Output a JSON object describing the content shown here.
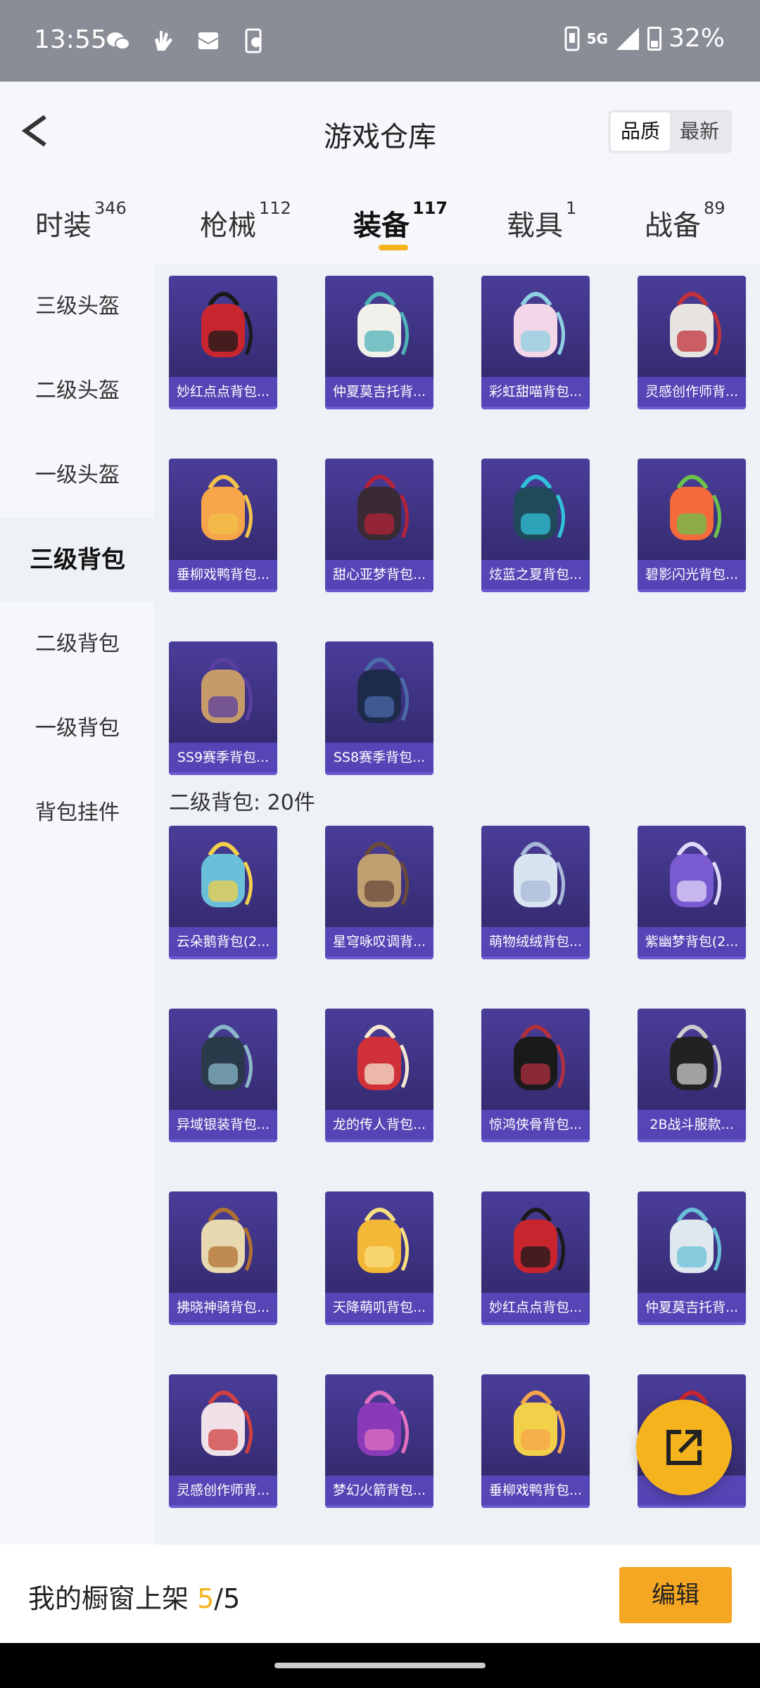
{
  "status_bar": {
    "time": "13:55",
    "network": "5G",
    "battery": "32%"
  },
  "header": {
    "title": "游戏仓库",
    "sort_options": [
      "品质",
      "最新"
    ]
  },
  "tabs": [
    {
      "label": "时装",
      "count": "346"
    },
    {
      "label": "枪械",
      "count": "112"
    },
    {
      "label": "装备",
      "count": "117"
    },
    {
      "label": "载具",
      "count": "1"
    },
    {
      "label": "战备",
      "count": "89"
    }
  ],
  "sidebar": {
    "items": [
      "三级头盔",
      "二级头盔",
      "一级头盔",
      "三级背包",
      "二级背包",
      "一级背包",
      "背包挂件"
    ],
    "active_index": 3
  },
  "level3_items": [
    "妙红点点背包...",
    "仲夏莫吉托背...",
    "彩虹甜喵背包...",
    "灵感创作师背...",
    "垂柳戏鸭背包...",
    "甜心亚梦背包...",
    "炫蓝之夏背包...",
    "碧影闪光背包...",
    "SS9赛季背包...",
    "SS8赛季背包..."
  ],
  "section_title": "二级背包: 20件",
  "level2_items": [
    "云朵鹅背包(2...",
    "星穹咏叹调背...",
    "萌物绒绒背包...",
    "紫幽梦背包(2...",
    "异域银装背包...",
    "龙的传人背包...",
    "惊鸿侠骨背包...",
    "2B战斗服款...",
    "拂晓神骑背包...",
    "天降萌叽背包...",
    "妙红点点背包...",
    "仲夏莫吉托背...",
    "灵感创作师背...",
    "梦幻火箭背包...",
    "垂柳戏鸭背包...",
    ""
  ],
  "bottom_bar": {
    "shelf_label": "我的橱窗上架 ",
    "shelf_count": "5",
    "shelf_total": "/5",
    "edit_label": "编辑"
  },
  "colors": {
    "accent": "#f4b31c",
    "card_bg": "#3b3080",
    "status_bar": "#8a8d96"
  }
}
